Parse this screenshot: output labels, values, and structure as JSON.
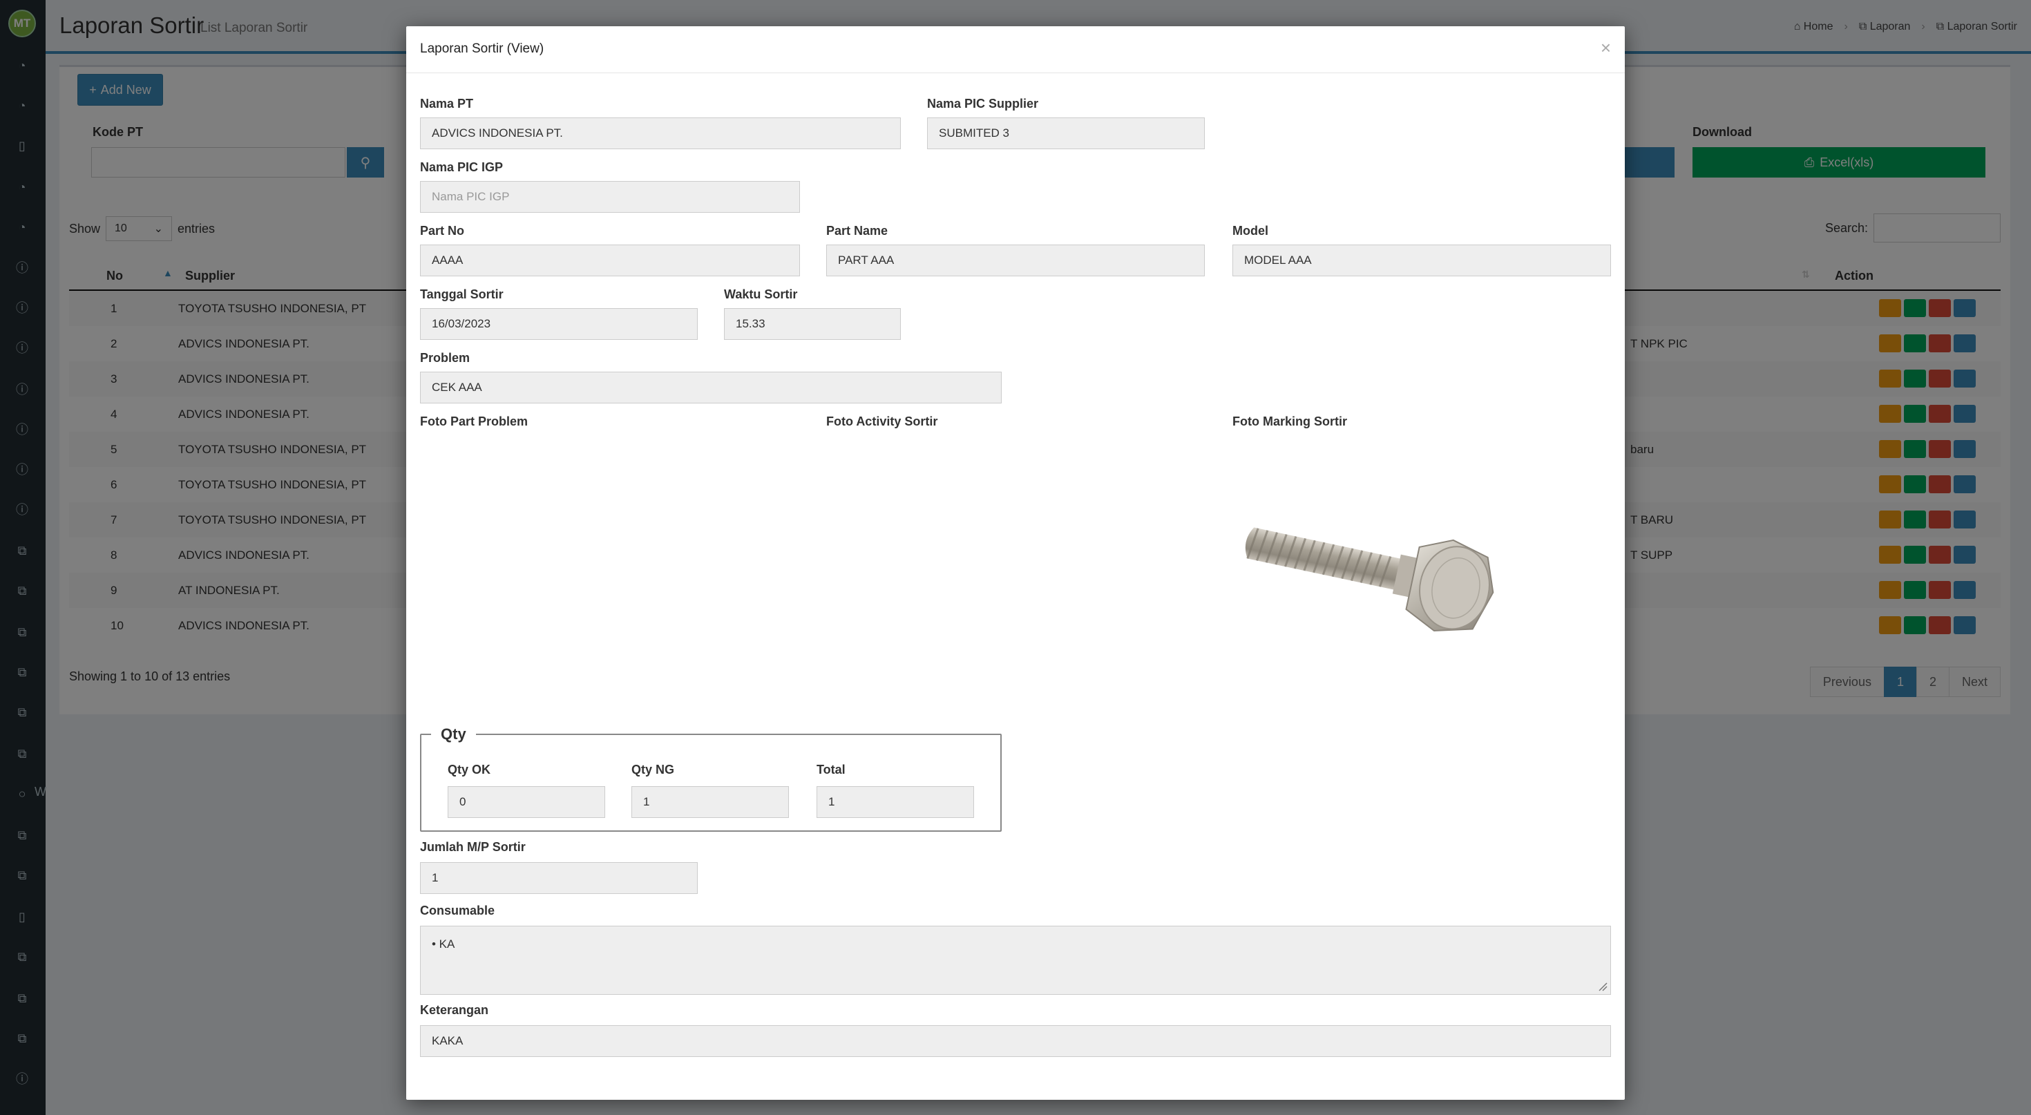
{
  "app": {
    "avatar_text": "MT",
    "sidebar_tail_text": "W",
    "page_title": "Laporan Sortir",
    "page_subtitle": "List Laporan Sortir",
    "breadcrumb": [
      "Home",
      "Laporan",
      "Laporan Sortir"
    ]
  },
  "toolbar": {
    "add_label": "Add New",
    "kode_pt_label": "Kode PT",
    "download_label": "Download",
    "excel_label": "Excel(xls)"
  },
  "table": {
    "show_label": "Show",
    "show_value": "10",
    "entries_label": "entries",
    "search_label": "Search:",
    "headers": {
      "no": "No",
      "supplier": "Supplier",
      "action": "Action"
    },
    "rows": [
      {
        "no": "1",
        "supplier": "TOYOTA TSUSHO INDONESIA, PT",
        "extra": ""
      },
      {
        "no": "2",
        "supplier": "ADVICS INDONESIA PT.",
        "extra": "T NPK PIC"
      },
      {
        "no": "3",
        "supplier": "ADVICS INDONESIA PT.",
        "extra": ""
      },
      {
        "no": "4",
        "supplier": "ADVICS INDONESIA PT.",
        "extra": ""
      },
      {
        "no": "5",
        "supplier": "TOYOTA TSUSHO INDONESIA, PT",
        "extra": "baru"
      },
      {
        "no": "6",
        "supplier": "TOYOTA TSUSHO INDONESIA, PT",
        "extra": ""
      },
      {
        "no": "7",
        "supplier": "TOYOTA TSUSHO INDONESIA, PT",
        "extra": "T BARU"
      },
      {
        "no": "8",
        "supplier": "ADVICS INDONESIA PT.",
        "extra": "T SUPP"
      },
      {
        "no": "9",
        "supplier": "AT INDONESIA PT.",
        "extra": ""
      },
      {
        "no": "10",
        "supplier": "ADVICS INDONESIA PT.",
        "extra": ""
      }
    ],
    "footer": "Showing 1 to 10 of 13 entries",
    "pagination": {
      "previous": "Previous",
      "pages": [
        "1",
        "2"
      ],
      "next": "Next"
    }
  },
  "modal": {
    "title": "Laporan Sortir (View)",
    "close": "×",
    "nama_pt": {
      "label": "Nama PT",
      "value": "ADVICS INDONESIA PT."
    },
    "nama_pic_supplier": {
      "label": "Nama PIC Supplier",
      "value": "SUBMITED 3"
    },
    "nama_pic_igp": {
      "label": "Nama PIC IGP",
      "placeholder": "Nama PIC IGP"
    },
    "part_no": {
      "label": "Part No",
      "value": "AAAA"
    },
    "part_name": {
      "label": "Part Name",
      "value": "PART AAA"
    },
    "model": {
      "label": "Model",
      "value": "MODEL AAA"
    },
    "tanggal_sortir": {
      "label": "Tanggal Sortir",
      "value": "16/03/2023"
    },
    "waktu_sortir": {
      "label": "Waktu Sortir",
      "value": "15.33"
    },
    "problem": {
      "label": "Problem",
      "value": "CEK AAA"
    },
    "foto_part_problem": {
      "label": "Foto Part Problem"
    },
    "foto_activity_sortir": {
      "label": "Foto Activity Sortir"
    },
    "foto_marking_sortir": {
      "label": "Foto Marking Sortir"
    },
    "qty": {
      "legend": "Qty",
      "ok": {
        "label": "Qty OK",
        "value": "0"
      },
      "ng": {
        "label": "Qty NG",
        "value": "1"
      },
      "total": {
        "label": "Total",
        "value": "1"
      }
    },
    "jumlah_mp": {
      "label": "Jumlah M/P Sortir",
      "value": "1"
    },
    "consumable": {
      "label": "Consumable",
      "value": "• KA"
    },
    "keterangan": {
      "label": "Keterangan",
      "value": "KAKA"
    }
  }
}
